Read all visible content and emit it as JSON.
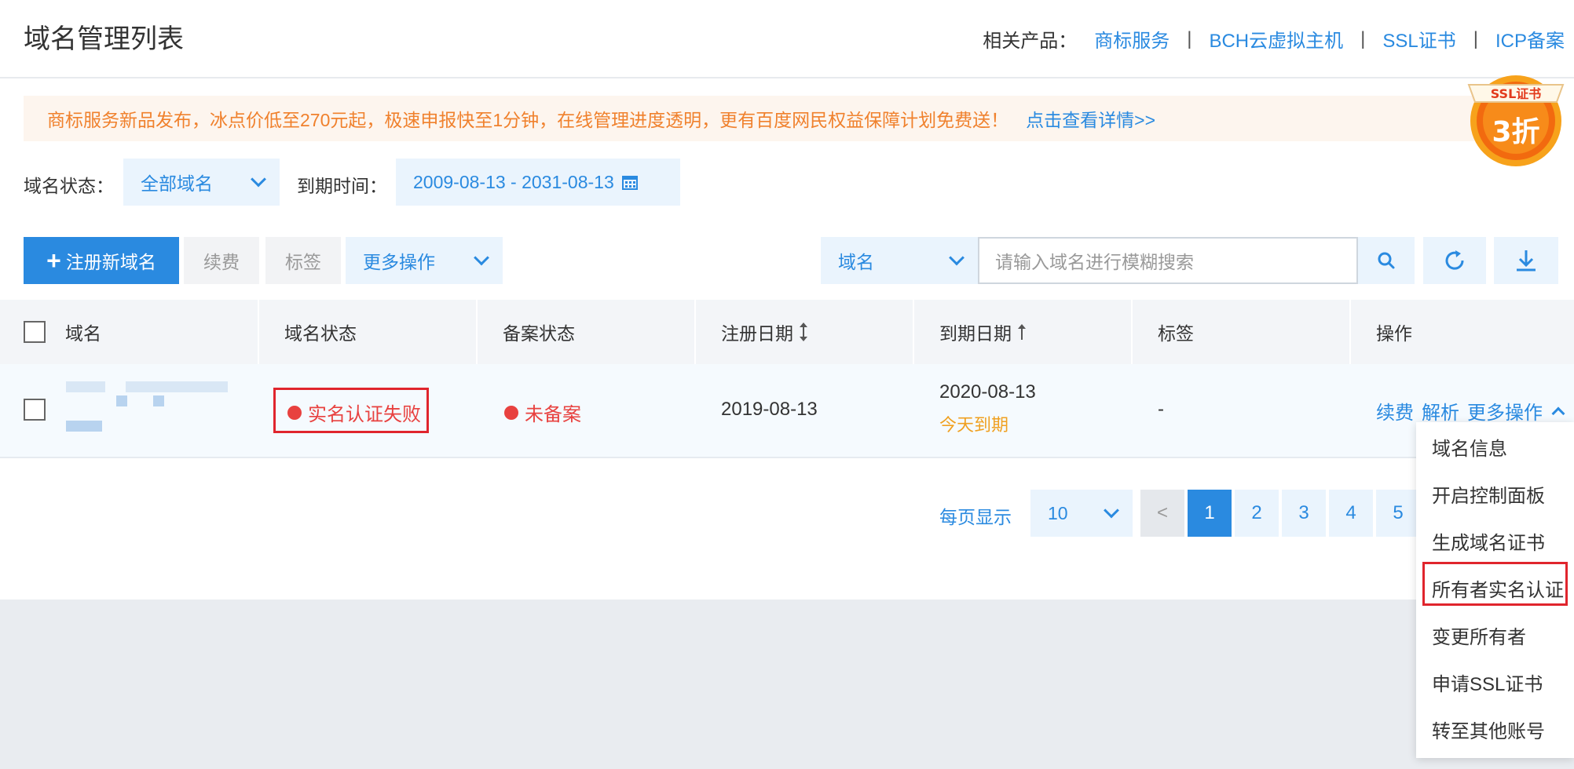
{
  "header": {
    "title": "域名管理列表",
    "related_label": "相关产品：",
    "related_links": [
      "商标服务",
      "BCH云虚拟主机",
      "SSL证书",
      "ICP备案"
    ],
    "separator": "|"
  },
  "notice": {
    "text": "商标服务新品发布，冰点价低至270元起，极速申报快至1分钟，在线管理进度透明，更有百度网民权益保障计划免费送！",
    "link": "点击查看详情>>"
  },
  "badge": {
    "top_text": "SSL证书",
    "main_text": "3折"
  },
  "filters": {
    "status_label": "域名状态：",
    "status_value": "全部域名",
    "expire_label": "到期时间：",
    "expire_range": "2009-08-13 - 2031-08-13"
  },
  "toolbar": {
    "register_label": "注册新域名",
    "renew_label": "续费",
    "tag_label": "标签",
    "more_label": "更多操作",
    "search_field": "域名",
    "search_placeholder": "请输入域名进行模糊搜索"
  },
  "table": {
    "columns": [
      "域名",
      "域名状态",
      "备案状态",
      "注册日期",
      "到期日期",
      "标签",
      "操作"
    ],
    "rows": [
      {
        "status": "实名认证失败",
        "icp": "未备案",
        "reg_date": "2019-08-13",
        "exp_date": "2020-08-13",
        "exp_note": "今天到期",
        "tag": "-",
        "actions": [
          "续费",
          "解析",
          "更多操作"
        ]
      }
    ]
  },
  "pagination": {
    "per_page_label": "每页显示",
    "per_page_value": "10",
    "prev": "<",
    "pages": [
      "1",
      "2",
      "3",
      "4",
      "5"
    ],
    "current": "1"
  },
  "more_menu": {
    "items": [
      "域名信息",
      "开启控制面板",
      "生成域名证书",
      "所有者实名认证",
      "变更所有者",
      "申请SSL证书",
      "转至其他账号"
    ],
    "highlighted": "所有者实名认证"
  },
  "colors": {
    "accent": "#2a8ae0",
    "error": "#e8413f",
    "warning": "#f0a020",
    "notice_text": "#f0812d",
    "highlight_box": "#e0252d"
  }
}
